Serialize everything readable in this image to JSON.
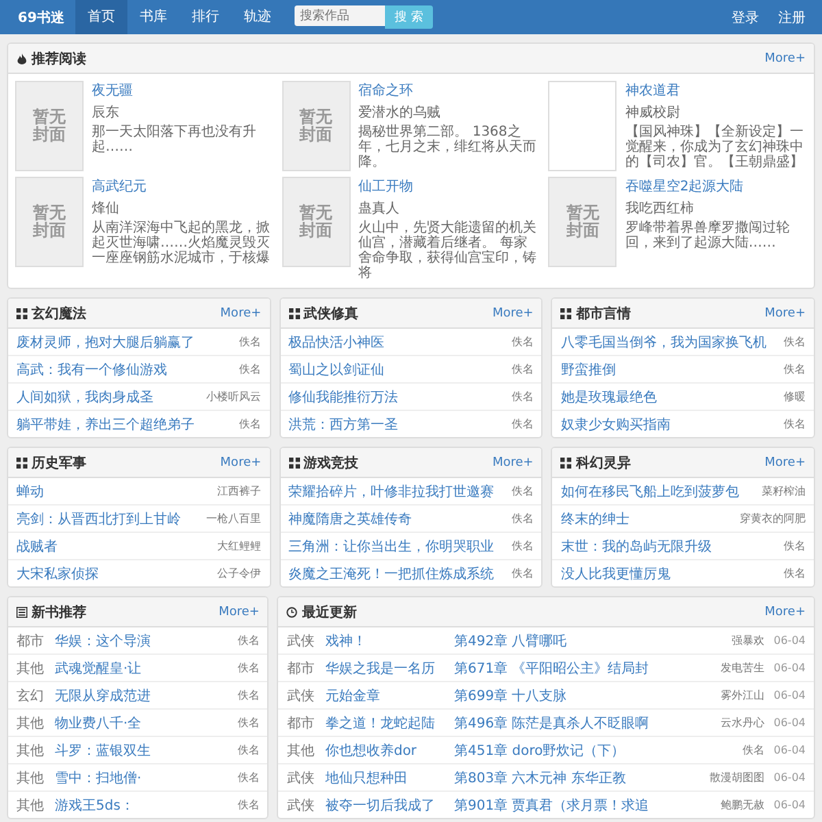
{
  "nav": {
    "logo": "69书迷",
    "items": [
      {
        "label": "首页",
        "selected": true
      },
      {
        "label": "书库",
        "selected": false
      },
      {
        "label": "排行",
        "selected": false
      },
      {
        "label": "轨迹",
        "selected": false
      }
    ],
    "search": {
      "placeholder": "搜索作品",
      "button": "搜 索"
    },
    "account": [
      "登录",
      "注册"
    ]
  },
  "recommend": {
    "title": "推荐阅读",
    "more": "More+",
    "books": [
      {
        "cover": "暂无封面",
        "title": "夜无疆",
        "author": "辰东",
        "desc": "那一天太阳落下再也没有升起……"
      },
      {
        "cover": "暂无封面",
        "title": "宿命之环",
        "author": "爱潜水的乌贼",
        "desc": "揭秘世界第二部。 1368之年，七月之末，绯红将从天而降。"
      },
      {
        "title": "神农道君",
        "author": "神威校尉",
        "desc": "【国风神珠】【全新设定】一觉醒来，你成为了玄幻神珠中的【司农】官。【王朝鼎盛】"
      },
      {
        "cover": "暂无封面",
        "title": "高武纪元",
        "author": "烽仙",
        "desc": "从南洋深海中飞起的黑龙，掀起灭世海啸……火焰魔灵毁灭一座座钢筋水泥城市，于核爆"
      },
      {
        "cover": "暂无封面",
        "title": "仙工开物",
        "author": "蛊真人",
        "desc": "火山中，先贤大能遗留的机关仙宫，潜藏着后继者。 每家舍命争取，获得仙宫宝印，铸将"
      },
      {
        "cover": "暂无封面",
        "title": "吞噬星空2起源大陆",
        "author": "我吃西红柿",
        "desc": "罗峰带着界兽摩罗撒闯过轮回，来到了起源大陆……"
      }
    ]
  },
  "categories": [
    {
      "title": "玄幻魔法",
      "more": "More+",
      "books": [
        {
          "title": "废材灵师，抱对大腿后躺赢了",
          "author": "佚名"
        },
        {
          "title": "高武：我有一个修仙游戏",
          "author": "佚名"
        },
        {
          "title": "人间如狱，我肉身成圣",
          "author": "小楼听风云"
        },
        {
          "title": "躺平带娃，养出三个超绝弟子",
          "author": "佚名"
        }
      ]
    },
    {
      "title": "武侠修真",
      "more": "More+",
      "books": [
        {
          "title": "极品快活小神医",
          "author": "佚名"
        },
        {
          "title": "蜀山之以剑证仙",
          "author": "佚名"
        },
        {
          "title": "修仙我能推衍万法",
          "author": "佚名"
        },
        {
          "title": "洪荒：西方第一圣",
          "author": "佚名"
        }
      ]
    },
    {
      "title": "都市言情",
      "more": "More+",
      "books": [
        {
          "title": "八零毛国当倒爷，我为国家换飞机",
          "author": "佚名"
        },
        {
          "title": "野蛮推倒",
          "author": "佚名"
        },
        {
          "title": "她是玫瑰最绝色",
          "author": "修暖"
        },
        {
          "title": "奴隶少女购买指南",
          "author": "佚名"
        }
      ]
    },
    {
      "title": "历史军事",
      "more": "More+",
      "books": [
        {
          "title": "蝉动",
          "author": "江西裤子"
        },
        {
          "title": "亮剑：从晋西北打到上甘岭",
          "author": "一枪八百里"
        },
        {
          "title": "战贼者",
          "author": "大红鲤鲤"
        },
        {
          "title": "大宋私家侦探",
          "author": "公子令伊"
        }
      ]
    },
    {
      "title": "游戏竞技",
      "more": "More+",
      "books": [
        {
          "title": "荣耀拾碎片，叶修非拉我打世邀赛",
          "author": "佚名"
        },
        {
          "title": "神魔隋唐之英雄传奇",
          "author": "佚名"
        },
        {
          "title": "三角洲：让你当出生，你明哭职业",
          "author": "佚名"
        },
        {
          "title": "炎魔之王淹死！一把抓住炼成系统",
          "author": "佚名"
        }
      ]
    },
    {
      "title": "科幻灵异",
      "more": "More+",
      "books": [
        {
          "title": "如何在移民飞船上吃到菠萝包",
          "author": "菜籽榨油"
        },
        {
          "title": "终末的绅士",
          "author": "穿黄衣的阿肥"
        },
        {
          "title": "末世：我的岛屿无限升级",
          "author": "佚名"
        },
        {
          "title": "没人比我更懂厉鬼",
          "author": "佚名"
        }
      ]
    }
  ],
  "new_books": {
    "title": "新书推荐",
    "more": "More+",
    "rows": [
      {
        "category": "都市",
        "title": "华娱：这个导演",
        "author": "佚名"
      },
      {
        "category": "其他",
        "title": "武魂觉醒皇·让",
        "author": "佚名"
      },
      {
        "category": "玄幻",
        "title": "无限从穿成范进",
        "author": "佚名"
      },
      {
        "category": "其他",
        "title": "物业费八千·全",
        "author": "佚名"
      },
      {
        "category": "其他",
        "title": "斗罗：蓝银双生",
        "author": "佚名"
      },
      {
        "category": "其他",
        "title": "雪中：扫地僧·",
        "author": "佚名"
      },
      {
        "category": "其他",
        "title": "游戏王5ds：",
        "author": "佚名"
      }
    ]
  },
  "updates": {
    "title": "最近更新",
    "more": "More+",
    "rows": [
      {
        "category": "武侠",
        "title": "戏神！",
        "chapter": "第492章 八臂哪吒",
        "author": "强暴欢",
        "date": "06-04"
      },
      {
        "category": "都市",
        "title": "华娱之我是一名历",
        "chapter": "第671章 《平阳昭公主》结局封",
        "author": "发电苦生",
        "date": "06-04"
      },
      {
        "category": "武侠",
        "title": "元始金章",
        "chapter": "第699章 十八支脉",
        "author": "雾外江山",
        "date": "06-04"
      },
      {
        "category": "都市",
        "title": "拳之道！龙蛇起陆",
        "chapter": "第496章 陈茫是真杀人不眨眼啊",
        "author": "云水丹心",
        "date": "06-04"
      },
      {
        "category": "其他",
        "title": "你也想收养dor",
        "chapter": "第451章 doro野炊记（下）",
        "author": "佚名",
        "date": "06-04"
      },
      {
        "category": "武侠",
        "title": "地仙只想种田",
        "chapter": "第803章 六木元神 东华正教",
        "author": "散漫胡图图",
        "date": "06-04"
      },
      {
        "category": "武侠",
        "title": "被夺一切后我成了",
        "chapter": "第901章 贾真君（求月票！求追",
        "author": "鲍鹏无赦",
        "date": "06-04"
      }
    ]
  }
}
